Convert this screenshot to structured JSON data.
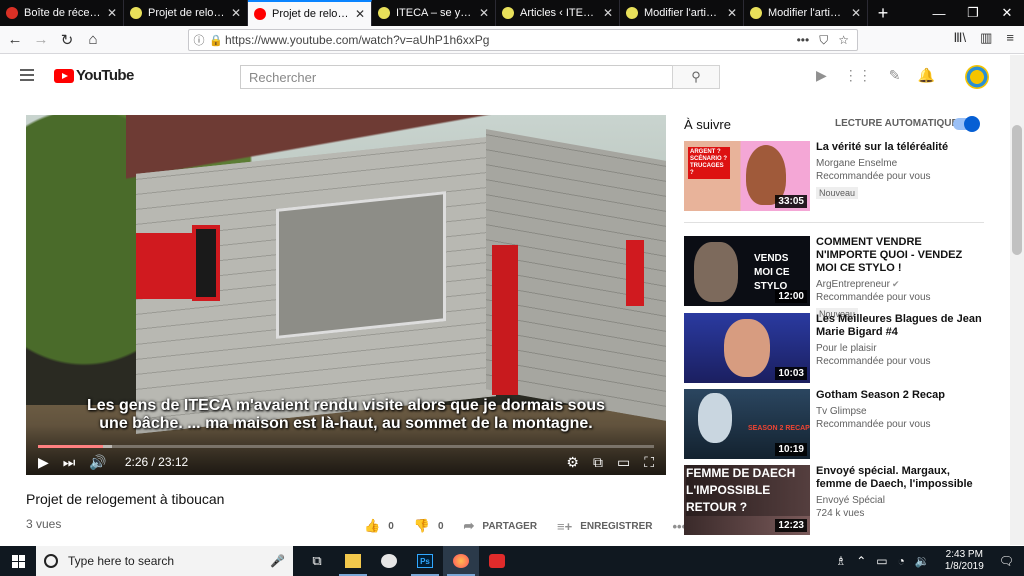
{
  "browser": {
    "tabs": [
      {
        "title": "Boîte de réception (",
        "favcolor": "#d93025",
        "active": false
      },
      {
        "title": "Projet de relogemen",
        "favcolor": "#e8e05a",
        "active": false
      },
      {
        "title": "Projet de relogem",
        "favcolor": "#ff0000",
        "active": true
      },
      {
        "title": "ITECA – se yon zout",
        "favcolor": "#e8e05a",
        "active": false
      },
      {
        "title": "Articles ‹ ITECA — V",
        "favcolor": "#e8e05a",
        "active": false
      },
      {
        "title": "Modifier l'article ‹ I",
        "favcolor": "#e8e05a",
        "active": false
      },
      {
        "title": "Modifier l'article ‹ I",
        "favcolor": "#e8e05a",
        "active": false
      }
    ],
    "url": "https://www.youtube.com/watch?v=aUhP1h6xxPg"
  },
  "youtube": {
    "logo_text": "YouTube",
    "search_placeholder": "Rechercher",
    "video": {
      "title": "Projet de relogement à tiboucan",
      "views": "3 vues",
      "subtitle_line1": "Les gens de ITECA m'avaient rendu visite alors que je dormais sous",
      "subtitle_line2": "une bâche. ... ma maison est là-haut, au sommet de la montagne.",
      "time": "2:26 / 23:12",
      "progress_fraction": 0.105,
      "buffer_fraction": 0.12,
      "likes": "0",
      "dislikes": "0",
      "share_label": "PARTAGER",
      "save_label": "ENREGISTRER"
    },
    "up_next_label": "À suivre",
    "autoplay_label": "LECTURE AUTOMATIQUE",
    "autoplay_on": true,
    "recommendations": [
      {
        "title": "La vérité sur la téléréalité",
        "channel": "Morgane Enselme",
        "sub": "Recommandée pour vous",
        "badge": "Nouveau",
        "duration": "33:05",
        "thumb_label": "ARGENT ? SCÉNARIO ? TRUCAGES ?"
      },
      {
        "title": "COMMENT VENDRE N'IMPORTE QUOI - VENDEZ MOI CE STYLO !",
        "channel": "ArgEntrepreneur",
        "sub": "Recommandée pour vous",
        "badge": "Nouveau",
        "duration": "12:00",
        "thumb_label": "VENDS MOI CE STYLO"
      },
      {
        "title": "Les Meilleures Blagues de Jean Marie Bigard #4",
        "channel": "Pour le plaisir",
        "sub": "Recommandée pour vous",
        "badge": "",
        "duration": "10:03",
        "thumb_label": ""
      },
      {
        "title": "Gotham Season 2 Recap",
        "channel": "Tv Glimpse",
        "sub": "Recommandée pour vous",
        "badge": "",
        "duration": "10:19",
        "thumb_label": "SEASON 2 RECAP"
      },
      {
        "title": "Envoyé spécial. Margaux, femme de Daech, l'impossible",
        "channel": "Envoyé Spécial",
        "sub": "724 k vues",
        "badge": "",
        "duration": "12:23",
        "thumb_label": "FEMME DE DAECH L'IMPOSSIBLE RETOUR ?"
      }
    ]
  },
  "taskbar": {
    "search_placeholder": "Type here to search",
    "time": "2:43 PM",
    "date": "1/8/2019"
  }
}
